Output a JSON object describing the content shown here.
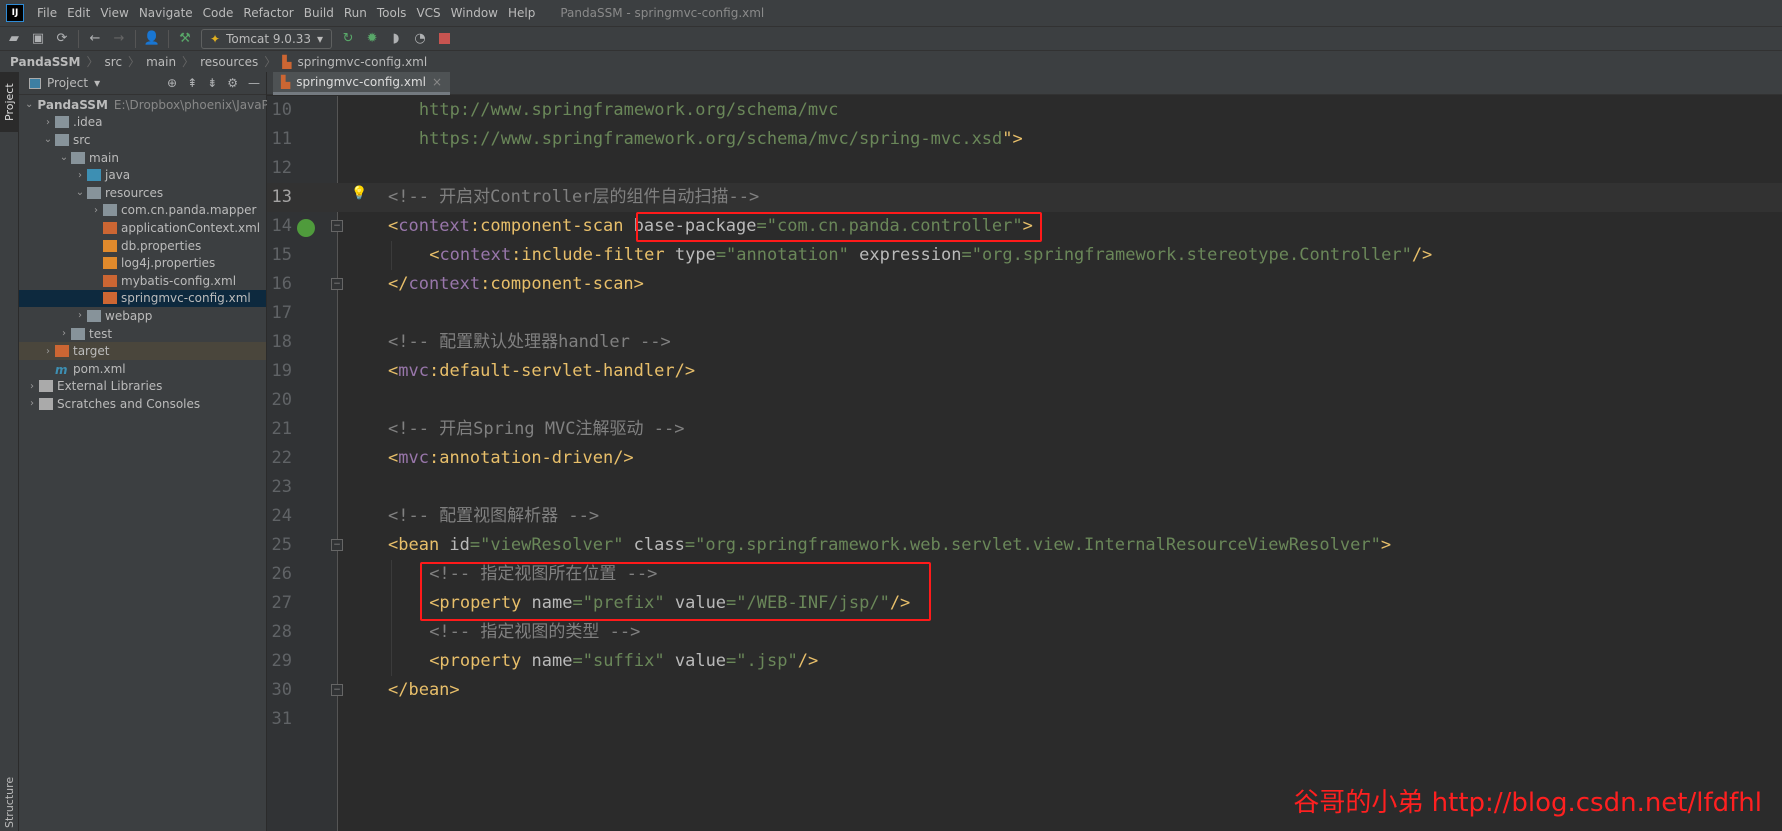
{
  "menu": {
    "items": [
      "File",
      "Edit",
      "View",
      "Navigate",
      "Code",
      "Refactor",
      "Build",
      "Run",
      "Tools",
      "VCS",
      "Window",
      "Help"
    ],
    "window_title": "PandaSSM - springmvc-config.xml"
  },
  "toolbar": {
    "run_config": "Tomcat 9.0.33"
  },
  "breadcrumb": [
    "PandaSSM",
    "src",
    "main",
    "resources",
    "springmvc-config.xml"
  ],
  "stripe": {
    "project_tab": "Project",
    "structure_tab": "Structure"
  },
  "project": {
    "title": "Project",
    "tree": [
      {
        "label": "PandaSSM",
        "hint": "E:\\Dropbox\\phoenix\\JavaPro",
        "depth": 0,
        "arrow": "down",
        "icon": "module",
        "bold": true
      },
      {
        "label": ".idea",
        "depth": 1,
        "arrow": "right",
        "icon": "folder"
      },
      {
        "label": "src",
        "depth": 1,
        "arrow": "down",
        "icon": "folder"
      },
      {
        "label": "main",
        "depth": 2,
        "arrow": "down",
        "icon": "folder"
      },
      {
        "label": "java",
        "depth": 3,
        "arrow": "right",
        "icon": "source-folder"
      },
      {
        "label": "resources",
        "depth": 3,
        "arrow": "down",
        "icon": "resources-folder"
      },
      {
        "label": "com.cn.panda.mapper",
        "depth": 4,
        "arrow": "right",
        "icon": "folder"
      },
      {
        "label": "applicationContext.xml",
        "depth": 4,
        "arrow": "",
        "icon": "spring-xml"
      },
      {
        "label": "db.properties",
        "depth": 4,
        "arrow": "",
        "icon": "properties"
      },
      {
        "label": "log4j.properties",
        "depth": 4,
        "arrow": "",
        "icon": "properties"
      },
      {
        "label": "mybatis-config.xml",
        "depth": 4,
        "arrow": "",
        "icon": "xml"
      },
      {
        "label": "springmvc-config.xml",
        "depth": 4,
        "arrow": "",
        "icon": "spring-xml",
        "selected": true
      },
      {
        "label": "webapp",
        "depth": 3,
        "arrow": "right",
        "icon": "web-folder"
      },
      {
        "label": "test",
        "depth": 2,
        "arrow": "right",
        "icon": "folder"
      },
      {
        "label": "target",
        "depth": 1,
        "arrow": "right",
        "icon": "excluded-folder",
        "target": true
      },
      {
        "label": "pom.xml",
        "depth": 1,
        "arrow": "",
        "icon": "maven"
      },
      {
        "label": "External Libraries",
        "depth": 0,
        "arrow": "right",
        "icon": "libraries"
      },
      {
        "label": "Scratches and Consoles",
        "depth": 0,
        "arrow": "right",
        "icon": "scratches"
      }
    ]
  },
  "editor": {
    "tab": "springmvc-config.xml",
    "current_line": 13,
    "lines": [
      {
        "n": 10,
        "indent": 3,
        "t": [
          [
            "u",
            "http://www.springframework.org/schema/mvc"
          ]
        ]
      },
      {
        "n": 11,
        "indent": 3,
        "t": [
          [
            "u",
            "https://www.springframework.org/schema/mvc/spring-mvc.xsd"
          ],
          [
            "p",
            "\">"
          ]
        ]
      },
      {
        "n": 12,
        "indent": 0,
        "t": []
      },
      {
        "n": 13,
        "indent": 0,
        "t": [
          [
            "c",
            "<!-- 开启对Controller层的组件自动扫描-->"
          ]
        ]
      },
      {
        "n": 14,
        "indent": 0,
        "t": [
          [
            "p",
            "<"
          ],
          [
            "ns",
            "context"
          ],
          [
            "p",
            ":component-scan "
          ],
          [
            "a",
            "base-package"
          ],
          [
            "v",
            "=\"com.cn.panda.controller\""
          ],
          [
            "p",
            ">"
          ]
        ]
      },
      {
        "n": 15,
        "indent": 4,
        "t": [
          [
            "p",
            "<"
          ],
          [
            "ns",
            "context"
          ],
          [
            "p",
            ":include-filter "
          ],
          [
            "a",
            "type"
          ],
          [
            "v",
            "=\"annotation\" "
          ],
          [
            "a",
            "expression"
          ],
          [
            "v",
            "=\"org.springframework.stereotype.Controller\""
          ],
          [
            "p",
            "/>"
          ]
        ]
      },
      {
        "n": 16,
        "indent": 0,
        "t": [
          [
            "p",
            "</"
          ],
          [
            "ns",
            "context"
          ],
          [
            "p",
            ":component-scan>"
          ]
        ]
      },
      {
        "n": 17,
        "indent": 0,
        "t": []
      },
      {
        "n": 18,
        "indent": 0,
        "t": [
          [
            "c",
            "<!-- 配置默认处理器handler -->"
          ]
        ]
      },
      {
        "n": 19,
        "indent": 0,
        "t": [
          [
            "p",
            "<"
          ],
          [
            "ns",
            "mvc"
          ],
          [
            "p",
            ":default-servlet-handler/>"
          ]
        ]
      },
      {
        "n": 20,
        "indent": 0,
        "t": []
      },
      {
        "n": 21,
        "indent": 0,
        "t": [
          [
            "c",
            "<!-- 开启Spring MVC注解驱动 -->"
          ]
        ]
      },
      {
        "n": 22,
        "indent": 0,
        "t": [
          [
            "p",
            "<"
          ],
          [
            "ns",
            "mvc"
          ],
          [
            "p",
            ":annotation-driven/>"
          ]
        ]
      },
      {
        "n": 23,
        "indent": 0,
        "t": []
      },
      {
        "n": 24,
        "indent": 0,
        "t": [
          [
            "c",
            "<!-- 配置视图解析器 -->"
          ]
        ]
      },
      {
        "n": 25,
        "indent": 0,
        "t": [
          [
            "p",
            "<bean "
          ],
          [
            "a",
            "id"
          ],
          [
            "v",
            "=\"viewResolver\" "
          ],
          [
            "a",
            "class"
          ],
          [
            "v",
            "=\"org.springframework.web.servlet.view.InternalResourceViewResolver\""
          ],
          [
            "p",
            ">"
          ]
        ]
      },
      {
        "n": 26,
        "indent": 4,
        "t": [
          [
            "c",
            "<!-- 指定视图所在位置 -->"
          ]
        ]
      },
      {
        "n": 27,
        "indent": 4,
        "t": [
          [
            "p",
            "<property "
          ],
          [
            "a",
            "name"
          ],
          [
            "v",
            "=\"prefix\" "
          ],
          [
            "a",
            "value"
          ],
          [
            "v",
            "=\"/WEB-INF/jsp/\""
          ],
          [
            "p",
            "/>"
          ]
        ]
      },
      {
        "n": 28,
        "indent": 4,
        "t": [
          [
            "c",
            "<!-- 指定视图的类型 -->"
          ]
        ]
      },
      {
        "n": 29,
        "indent": 4,
        "t": [
          [
            "p",
            "<property "
          ],
          [
            "a",
            "name"
          ],
          [
            "v",
            "=\"suffix\" "
          ],
          [
            "a",
            "value"
          ],
          [
            "v",
            "=\".jsp\""
          ],
          [
            "p",
            "/>"
          ]
        ]
      },
      {
        "n": 30,
        "indent": 0,
        "t": [
          [
            "p",
            "</bean>"
          ]
        ]
      },
      {
        "n": 31,
        "indent": 0,
        "t": []
      }
    ]
  },
  "watermark": "谷哥的小弟 http://blog.csdn.net/lfdfhl",
  "colors": {
    "accent_red": "#ff1a1a",
    "tag": "#e8bf6a",
    "namespace": "#9876aa",
    "value": "#6a8759",
    "comment": "#808080"
  }
}
